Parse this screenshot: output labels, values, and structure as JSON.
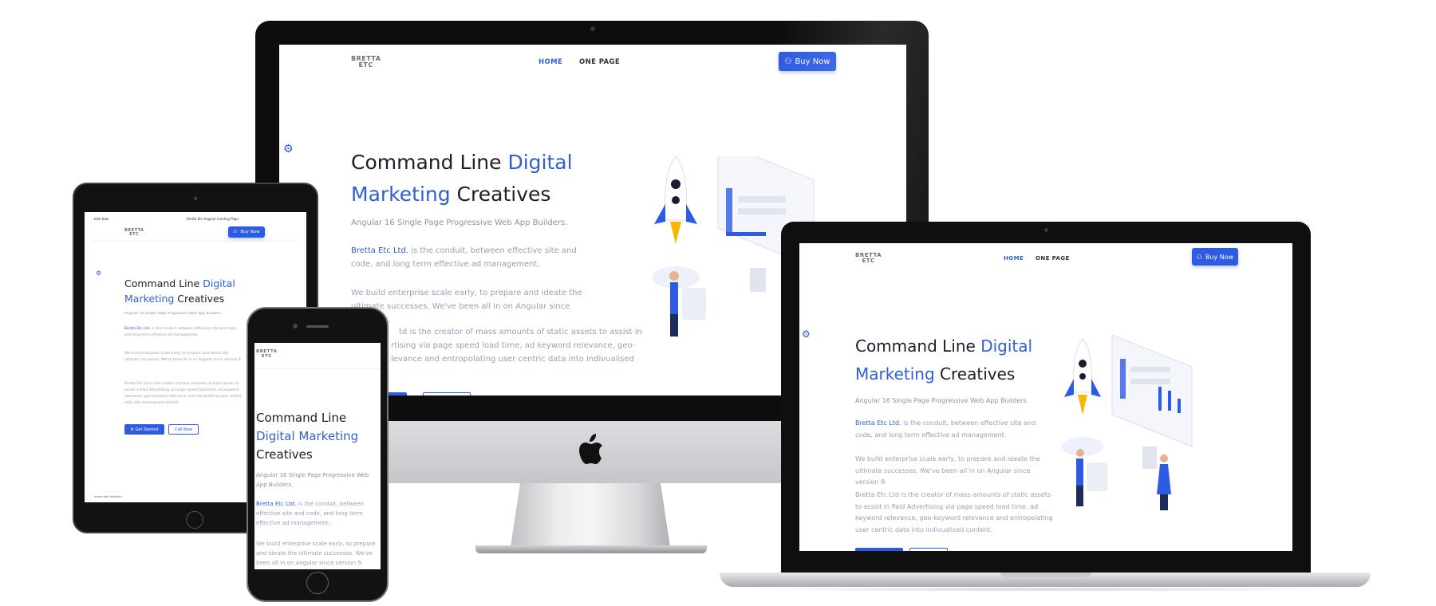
{
  "site": {
    "logo_line1": "BRETTA",
    "logo_line2": "ETC",
    "nav": [
      {
        "label": "HOME",
        "active": true
      },
      {
        "label": "ONE PAGE",
        "active": false
      }
    ],
    "buy_label": "Buy Now",
    "hero": {
      "title_part1": "Command Line ",
      "title_part2": "Digital",
      "title_part3": "Marketing",
      "title_part4": " Creatives",
      "phone_title_line1": "Command Line",
      "phone_title_line2": "Digital Marketing",
      "phone_title_line3": "Creatives",
      "subtitle": "Angular 16 Single Page Progressive Web App Builders.",
      "para1_link": "Bretta Etc Ltd.",
      "para1_rest": " is the conduit, between effective site and code, and long term effective ad management.",
      "para2": "We build enterprise scale early, to prepare and ideate the ultimate successes. We've been all in on Angular since version 9.",
      "para3": "Bretta Etc Ltd is the creator of mass amounts of static assets to assist in Paid Advertising via page speed load time, ad keyword relevance, geo-keyword relevance and entropolating user centric data into indivualised content.",
      "imac_para3_partial": "td is the creator of mass amounts of static assets to assist in",
      "imac_para3_partial2": "rtising via page speed load time, ad keyword relevance, geo-",
      "imac_para3_partial3": "levance and entropolating user centric data into indivualised",
      "get_started_label": "Get Started",
      "call_now_label": "Call Now"
    },
    "tablet_topbar_left": "blah blah",
    "tablet_topbar_center": "Bretta Etc Angular Landing Page",
    "tablet_footer": "made with blahblah"
  },
  "colors": {
    "accent": "#2d5be3",
    "link": "#2f5fd1",
    "text_dark": "#1d1d2b",
    "text_muted": "#98a0b3"
  },
  "icons": {
    "gear": "gear-icon",
    "user": "user-icon",
    "apple": "apple-logo-icon"
  }
}
